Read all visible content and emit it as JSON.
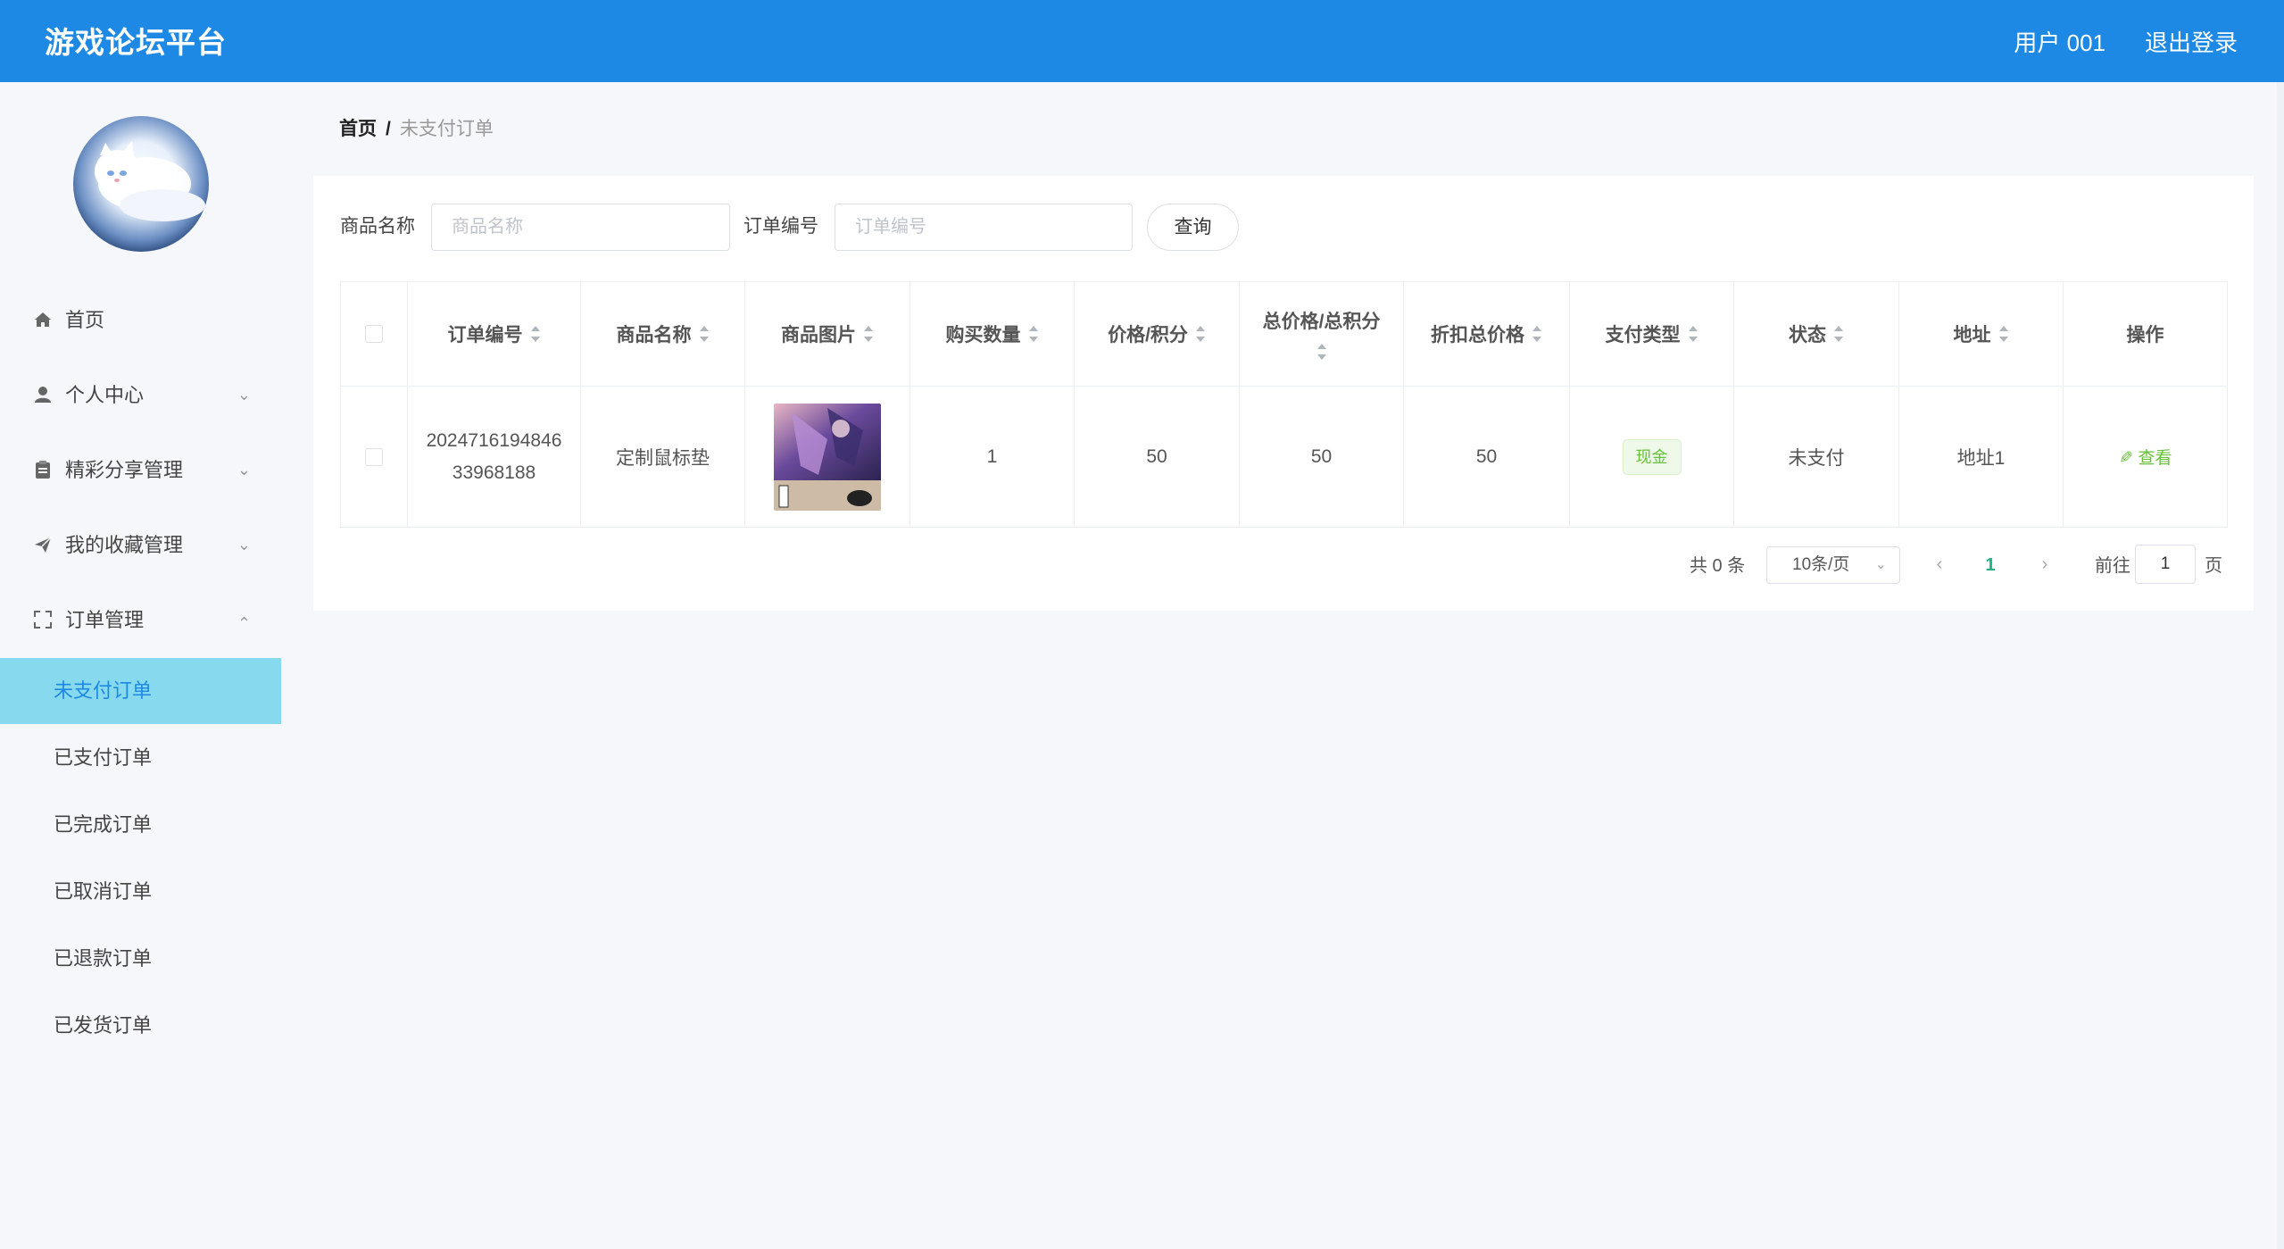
{
  "header": {
    "app_title": "游戏论坛平台",
    "user_label": "用户 001",
    "logout_label": "退出登录"
  },
  "sidebar": {
    "menu": [
      {
        "label": "首页",
        "icon": "home-icon"
      },
      {
        "label": "个人中心",
        "icon": "user-icon",
        "arrow": "chevron-down-icon"
      },
      {
        "label": "精彩分享管理",
        "icon": "clipboard-icon",
        "arrow": "chevron-down-icon"
      },
      {
        "label": "我的收藏管理",
        "icon": "send-icon",
        "arrow": "chevron-down-icon"
      },
      {
        "label": "订单管理",
        "icon": "fullscreen-icon",
        "arrow": "chevron-up-icon"
      }
    ],
    "submenu": [
      {
        "label": "未支付订单",
        "active": true
      },
      {
        "label": "已支付订单"
      },
      {
        "label": "已完成订单"
      },
      {
        "label": "已取消订单"
      },
      {
        "label": "已退款订单"
      },
      {
        "label": "已发货订单"
      }
    ]
  },
  "breadcrumb": {
    "home": "首页",
    "separator": "/",
    "current": "未支付订单"
  },
  "search": {
    "product_name_label": "商品名称",
    "product_name_placeholder": "商品名称",
    "order_no_label": "订单编号",
    "order_no_placeholder": "订单编号",
    "query_label": "查询"
  },
  "table": {
    "headers": [
      "订单编号",
      "商品名称",
      "商品图片",
      "购买数量",
      "价格/积分",
      "总价格/总积分",
      "折扣总价格",
      "支付类型",
      "状态",
      "地址",
      "操作"
    ],
    "rows": [
      {
        "order_no_line1": "2024716194846",
        "order_no_line2": "33968188",
        "product_name": "定制鼠标垫",
        "quantity": "1",
        "price": "50",
        "total_price": "50",
        "discount_total": "50",
        "pay_type": "现金",
        "status": "未支付",
        "address": "地址1",
        "action": "查看"
      }
    ]
  },
  "pagination": {
    "total": "共 0 条",
    "page_size": "10条/页",
    "current_page": "1",
    "goto_label": "前往",
    "goto_value": "1",
    "page_suffix": "页"
  },
  "colors": {
    "header_bg": "#1d89e4",
    "active_menu_bg": "#87d9ee",
    "active_page": "#21b183",
    "tag_green": "#67c23a"
  }
}
